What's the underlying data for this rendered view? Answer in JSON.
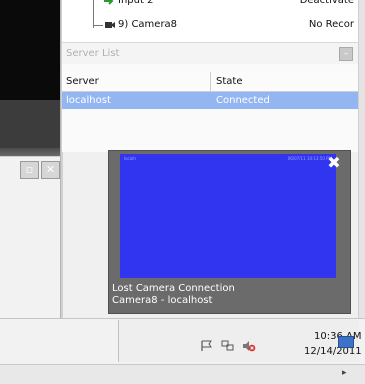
{
  "camera_tree": {
    "rows": [
      {
        "name": "Input 2",
        "state": "Deactivate"
      },
      {
        "name": "9) Camera8",
        "state": "No Recor"
      }
    ]
  },
  "server_list": {
    "title": "Server List",
    "minimize_glyph": "–",
    "columns": [
      "Server",
      "State"
    ],
    "rows": [
      {
        "server": "localhost",
        "state": "Connected"
      }
    ]
  },
  "left_panel": {
    "buttons": [
      "▫",
      "✕"
    ]
  },
  "popup": {
    "tag_left": "localh",
    "tag_right": "06/07/11 10:13:50 PM",
    "close_glyph": "✖",
    "message_line1": "Lost Camera Connection",
    "message_line2": "Camera8 - localhost"
  },
  "taskbar": {
    "clock_time": "10:36 AM",
    "clock_date": "12/14/2011",
    "tray_icons": [
      "flag-icon",
      "network-icon",
      "volume-muted-icon"
    ]
  },
  "scroll": {
    "arrow": "▸"
  },
  "colors": {
    "selection": "#93b6f2",
    "video": "#3235f0",
    "popup": "#6b6b6b"
  }
}
